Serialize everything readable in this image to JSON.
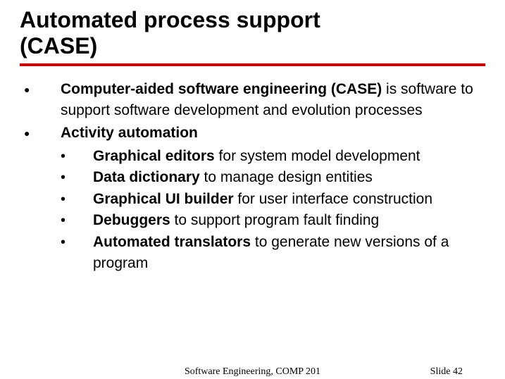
{
  "title_line1": "Automated process support",
  "title_line2": "(CASE)",
  "bullets": [
    {
      "html": "<b>Computer-aided software engineering (CASE)</b> is software to support software development and evolution processes"
    },
    {
      "html": "<b>Activity automation</b>",
      "sub": [
        {
          "html": "<b>Graphical editors</b> for system model development"
        },
        {
          "html": "<b>Data dictionary</b> to manage design entities"
        },
        {
          "html": "<b>Graphical UI builder</b> for user interface construction"
        },
        {
          "html": "<b>Debuggers</b> to support program fault finding"
        },
        {
          "html": "<b>Automated translators</b> to generate new versions of a program"
        }
      ]
    }
  ],
  "footer": {
    "course": "Software Engineering, COMP 201",
    "page_prefix": "Slide ",
    "page_number": "42"
  }
}
